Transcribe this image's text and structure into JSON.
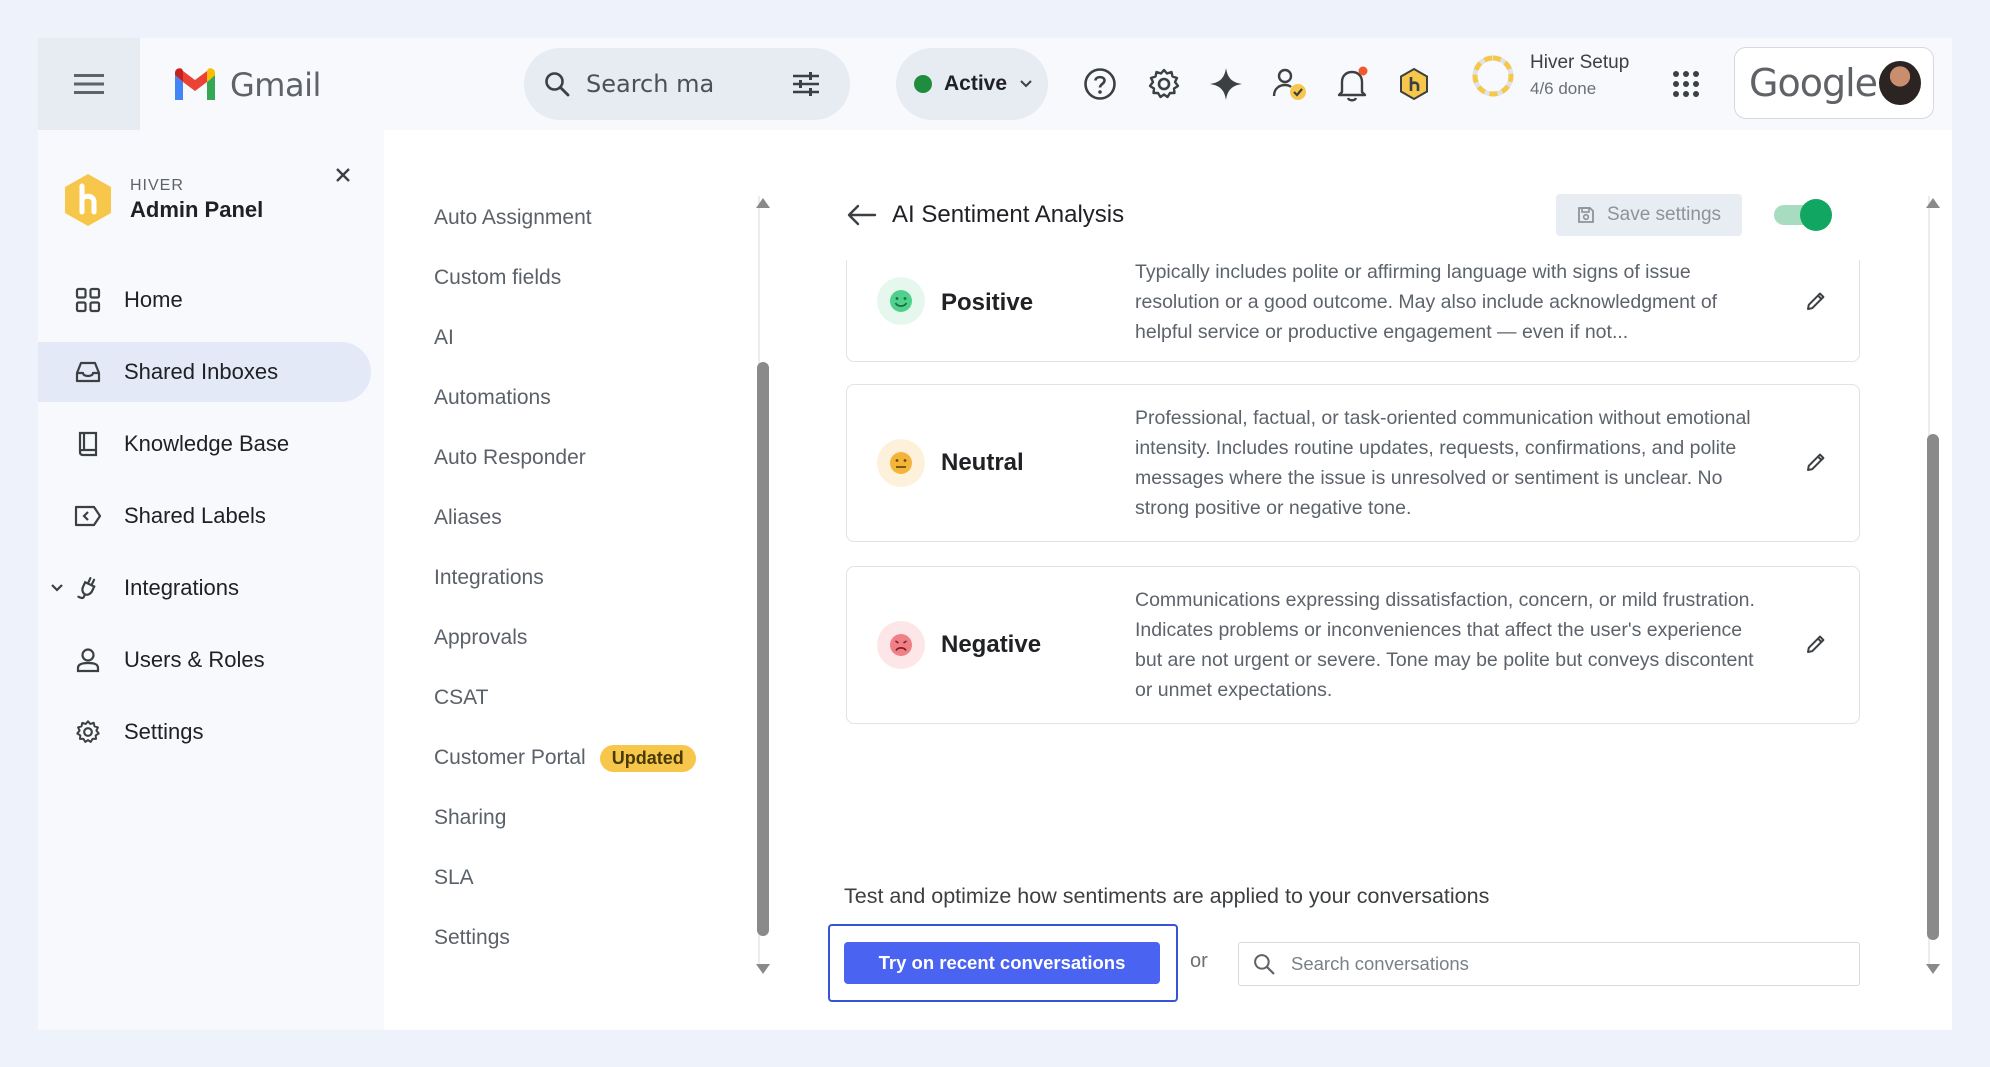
{
  "topbar": {
    "app_name": "Gmail",
    "search_placeholder": "Search ma",
    "status_label": "Active",
    "setup_title": "Hiver Setup",
    "setup_progress": "4/6 done",
    "account_brand": "Google",
    "icons": [
      "menu-icon",
      "search-icon",
      "filter-icon",
      "chevron-down-icon",
      "help-icon",
      "gear-icon",
      "sparkle-icon",
      "user-check-icon",
      "bell-icon",
      "hiver-badge-icon",
      "progress-ring-icon",
      "apps-grid-icon"
    ]
  },
  "admin": {
    "brand_sup": "HIVER",
    "brand_title": "Admin Panel",
    "nav": [
      {
        "label": "Home",
        "icon": "grid-icon"
      },
      {
        "label": "Shared Inboxes",
        "icon": "inbox-icon",
        "active": true
      },
      {
        "label": "Knowledge Base",
        "icon": "book-icon"
      },
      {
        "label": "Shared Labels",
        "icon": "label-icon"
      },
      {
        "label": "Integrations",
        "icon": "plug-icon"
      },
      {
        "label": "Users & Roles",
        "icon": "user-icon"
      },
      {
        "label": "Settings",
        "icon": "gear-icon"
      }
    ]
  },
  "subnav": {
    "items": [
      "Auto Assignment",
      "Custom fields",
      "AI",
      "Automations",
      "Auto Responder",
      "Aliases",
      "Integrations",
      "Approvals",
      "CSAT",
      "Customer Portal",
      "Sharing",
      "SLA",
      "Settings"
    ],
    "badge": "Updated"
  },
  "panel": {
    "title": "AI Sentiment Analysis",
    "save_label": "Save settings",
    "enabled": true,
    "sentiments": [
      {
        "name": "Positive",
        "desc": "Typically includes polite or affirming language with signs of issue resolution or a good outcome. May also include acknowledgment of helpful service or productive engagement — even if not..."
      },
      {
        "name": "Neutral",
        "desc": "Professional, factual, or task-oriented communication without emotional intensity. Includes routine updates, requests, confirmations, and polite messages where the issue is unresolved or sentiment is unclear. No strong positive or negative tone."
      },
      {
        "name": "Negative",
        "desc": "Communications expressing dissatisfaction, concern, or mild frustration. Indicates problems or inconveniences that affect the user's experience but are not urgent or severe. Tone may be polite but conveys discontent or unmet expectations."
      }
    ],
    "test_text": "Test and optimize how sentiments are applied to your conversations",
    "try_label": "Try on recent conversations",
    "or_label": "or",
    "search_placeholder": "Search conversations"
  },
  "colors": {
    "accent": "#4a63f0",
    "toggle_on": "#11a661",
    "status_active": "#1e8e3e",
    "badge": "#f6c74a",
    "positive": "#2fbf71",
    "neutral": "#f2b233",
    "negative": "#e4606a"
  }
}
